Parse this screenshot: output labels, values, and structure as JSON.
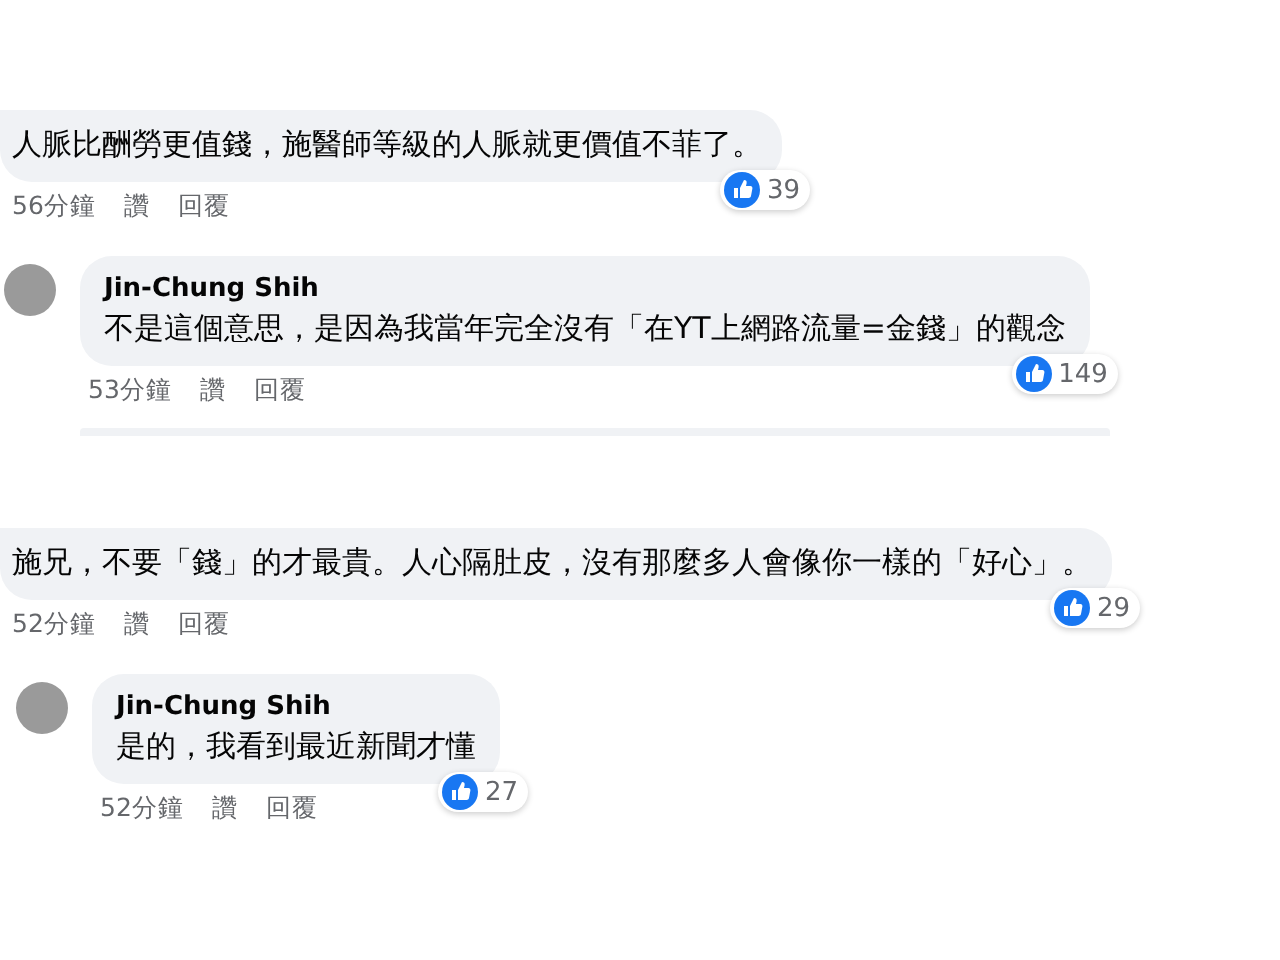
{
  "threads": [
    {
      "comment": {
        "text": "人脈比酬勞更值錢，施醫師等級的人脈就更價值不菲了。",
        "time": "56分鐘",
        "like_action": "讚",
        "reply_action": "回覆",
        "likes": "39"
      },
      "reply": {
        "author": "Jin-Chung Shih",
        "text": "不是這個意思，是因為我當年完全沒有「在YT上網路流量=金錢」的觀念",
        "time": "53分鐘",
        "like_action": "讚",
        "reply_action": "回覆",
        "likes": "149"
      }
    },
    {
      "comment": {
        "text": "施兄，不要「錢」的才最貴。人心隔肚皮，沒有那麼多人會像你一樣的「好心」。",
        "time": "52分鐘",
        "like_action": "讚",
        "reply_action": "回覆",
        "likes": "29"
      },
      "reply": {
        "author": "Jin-Chung Shih",
        "text": "是的，我看到最近新聞才懂",
        "time": "52分鐘",
        "like_action": "讚",
        "reply_action": "回覆",
        "likes": "27"
      }
    }
  ]
}
